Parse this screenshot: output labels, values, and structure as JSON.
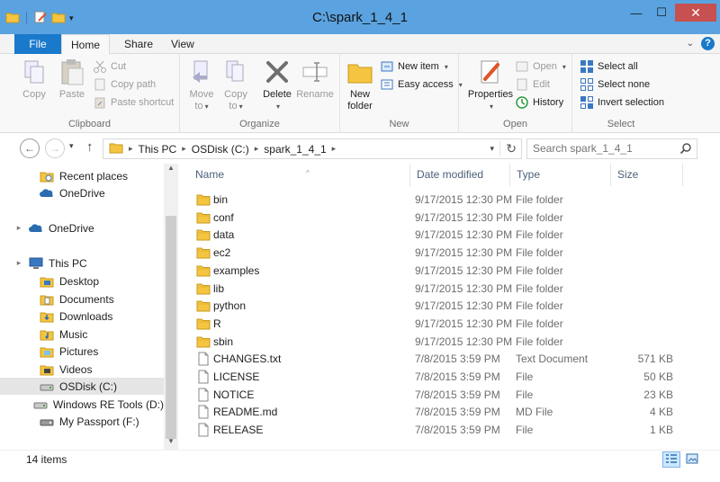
{
  "window": {
    "title": "C:\\spark_1_4_1"
  },
  "titlebar": {
    "minimize": "—",
    "maximize": "☐",
    "close": "✕"
  },
  "tabs": {
    "file": "File",
    "home": "Home",
    "share": "Share",
    "view": "View",
    "help": "?"
  },
  "ribbon": {
    "clipboard": {
      "label": "Clipboard",
      "copy": "Copy",
      "paste": "Paste",
      "cut": "Cut",
      "copy_path": "Copy path",
      "paste_shortcut": "Paste shortcut"
    },
    "organize": {
      "label": "Organize",
      "move_to": [
        "Move",
        "to"
      ],
      "copy_to": [
        "Copy",
        "to"
      ],
      "delete": "Delete",
      "rename": "Rename"
    },
    "new": {
      "label": "New",
      "new_folder": [
        "New",
        "folder"
      ],
      "new_item": "New item",
      "easy_access": "Easy access"
    },
    "open": {
      "label": "Open",
      "properties": "Properties",
      "open": "Open",
      "edit": "Edit",
      "history": "History"
    },
    "select": {
      "label": "Select",
      "select_all": "Select all",
      "select_none": "Select none",
      "invert_selection": "Invert selection"
    }
  },
  "address": {
    "crumbs": [
      "This PC",
      "OSDisk (C:)",
      "spark_1_4_1"
    ],
    "search_placeholder": "Search spark_1_4_1"
  },
  "nav": {
    "items": [
      {
        "label": "Recent places",
        "icon": "recent-places-icon"
      },
      {
        "label": "OneDrive",
        "icon": "onedrive-icon"
      },
      {
        "label": "OneDrive",
        "icon": "onedrive-icon"
      },
      {
        "label": "This PC",
        "icon": "computer-icon"
      },
      {
        "label": "Desktop",
        "icon": "desktop-folder-icon"
      },
      {
        "label": "Documents",
        "icon": "documents-folder-icon"
      },
      {
        "label": "Downloads",
        "icon": "downloads-folder-icon"
      },
      {
        "label": "Music",
        "icon": "music-folder-icon"
      },
      {
        "label": "Pictures",
        "icon": "pictures-folder-icon"
      },
      {
        "label": "Videos",
        "icon": "videos-folder-icon"
      },
      {
        "label": "OSDisk (C:)",
        "icon": "drive-icon"
      },
      {
        "label": "Windows RE Tools (D:)",
        "icon": "drive-icon"
      },
      {
        "label": "My Passport (F:)",
        "icon": "usb-drive-icon"
      }
    ]
  },
  "columns": {
    "name": "Name",
    "date": "Date modified",
    "type": "Type",
    "size": "Size"
  },
  "files": [
    {
      "name": "bin",
      "date": "9/17/2015 12:30 PM",
      "type": "File folder",
      "size": "",
      "kind": "folder"
    },
    {
      "name": "conf",
      "date": "9/17/2015 12:30 PM",
      "type": "File folder",
      "size": "",
      "kind": "folder"
    },
    {
      "name": "data",
      "date": "9/17/2015 12:30 PM",
      "type": "File folder",
      "size": "",
      "kind": "folder"
    },
    {
      "name": "ec2",
      "date": "9/17/2015 12:30 PM",
      "type": "File folder",
      "size": "",
      "kind": "folder"
    },
    {
      "name": "examples",
      "date": "9/17/2015 12:30 PM",
      "type": "File folder",
      "size": "",
      "kind": "folder"
    },
    {
      "name": "lib",
      "date": "9/17/2015 12:30 PM",
      "type": "File folder",
      "size": "",
      "kind": "folder"
    },
    {
      "name": "python",
      "date": "9/17/2015 12:30 PM",
      "type": "File folder",
      "size": "",
      "kind": "folder"
    },
    {
      "name": "R",
      "date": "9/17/2015 12:30 PM",
      "type": "File folder",
      "size": "",
      "kind": "folder"
    },
    {
      "name": "sbin",
      "date": "9/17/2015 12:30 PM",
      "type": "File folder",
      "size": "",
      "kind": "folder"
    },
    {
      "name": "CHANGES.txt",
      "date": "7/8/2015 3:59 PM",
      "type": "Text Document",
      "size": "571 KB",
      "kind": "file"
    },
    {
      "name": "LICENSE",
      "date": "7/8/2015 3:59 PM",
      "type": "File",
      "size": "50 KB",
      "kind": "file"
    },
    {
      "name": "NOTICE",
      "date": "7/8/2015 3:59 PM",
      "type": "File",
      "size": "23 KB",
      "kind": "file"
    },
    {
      "name": "README.md",
      "date": "7/8/2015 3:59 PM",
      "type": "MD File",
      "size": "4 KB",
      "kind": "file"
    },
    {
      "name": "RELEASE",
      "date": "7/8/2015 3:59 PM",
      "type": "File",
      "size": "1 KB",
      "kind": "file"
    }
  ],
  "status": {
    "count": "14 items"
  },
  "colors": {
    "accent": "#1979ca",
    "titlebar": "#5aa3e0",
    "close": "#c75050",
    "folder": "#f5c542"
  }
}
